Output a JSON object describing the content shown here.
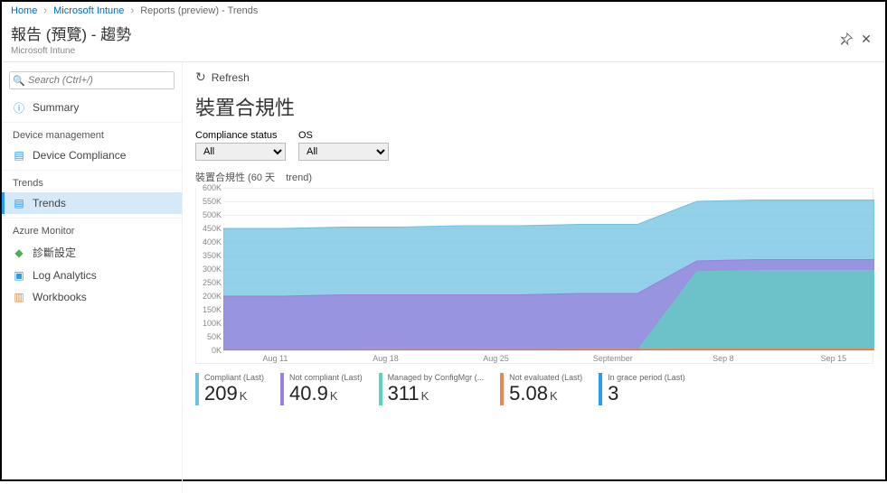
{
  "breadcrumb": {
    "home": "Home",
    "intune": "Microsoft Intune",
    "reports": "Reports (preview) - Trends"
  },
  "header": {
    "title": "報告 (預覽) - 趨勢",
    "subtitle": "Microsoft Intune"
  },
  "sidebar": {
    "search_placeholder": "Search (Ctrl+/)",
    "summary": "Summary",
    "sections": {
      "device_mgmt": "Device management",
      "trends_section": "Trends",
      "azure_monitor": "Azure Monitor"
    },
    "items": {
      "device_compliance": "Device Compliance",
      "trends": "Trends",
      "diag_settings": "診斷設定",
      "log_analytics": "Log Analytics",
      "workbooks": "Workbooks"
    }
  },
  "toolbar": {
    "refresh": "Refresh"
  },
  "page_title": "裝置合規性",
  "filters": {
    "compliance_label": "Compliance status",
    "compliance_value": "All",
    "os_label": "OS",
    "os_value": "All"
  },
  "chart_title_prefix": "裝置合規性 (60 天",
  "chart_title_suffix": "trend)",
  "chart_data": {
    "type": "area",
    "ylabel": "",
    "xlabel": "",
    "ylim": [
      0,
      600000
    ],
    "y_ticks": [
      "0K",
      "50K",
      "100K",
      "150K",
      "200K",
      "250K",
      "300K",
      "350K",
      "400K",
      "450K",
      "500K",
      "550K",
      "600K"
    ],
    "x_ticks": [
      "Aug 11",
      "Aug 18",
      "Aug 25",
      "September",
      "Sep 8",
      "Sep 15"
    ],
    "x_tick_positions_pct": [
      8,
      25,
      42,
      60,
      77,
      94
    ],
    "series": [
      {
        "name": "Compliant (Last)",
        "color": "#6fc2e0",
        "values_k": [
          450,
          450,
          455,
          455,
          460,
          460,
          465,
          465,
          550,
          555,
          555,
          555
        ]
      },
      {
        "name": "Not compliant (Last)",
        "color": "#9a7fdc",
        "values_k": [
          200,
          200,
          205,
          205,
          205,
          205,
          210,
          210,
          330,
          335,
          335,
          335
        ]
      },
      {
        "name": "Managed by ConfigMgr (Last)",
        "color": "#5fd0c0",
        "values_k": [
          0,
          0,
          0,
          0,
          0,
          0,
          0,
          0,
          290,
          295,
          295,
          295
        ]
      },
      {
        "name": "Not evaluated (Last)",
        "color": "#e78955",
        "values_k": [
          2,
          2,
          2,
          3,
          3,
          3,
          4,
          4,
          5,
          5,
          5,
          5
        ]
      },
      {
        "name": "In grace period (Last)",
        "color": "#2899f5",
        "values_k": [
          0,
          0,
          0,
          0,
          0,
          0,
          0,
          0,
          0,
          0,
          0,
          0
        ]
      }
    ]
  },
  "metrics": [
    {
      "label": "Compliant (Last)",
      "value": "209",
      "unit": "K",
      "color": "#6fc2e0"
    },
    {
      "label": "Not compliant (Last)",
      "value": "40.9",
      "unit": "K",
      "color": "#9a7fdc"
    },
    {
      "label": "Managed by ConfigMgr (...",
      "value": "311",
      "unit": "K",
      "color": "#5fd0c0"
    },
    {
      "label": "Not evaluated (Last)",
      "value": "5.08",
      "unit": "K",
      "color": "#e78955"
    },
    {
      "label": "In grace period (Last)",
      "value": "3",
      "unit": "",
      "color": "#2899f5"
    }
  ]
}
